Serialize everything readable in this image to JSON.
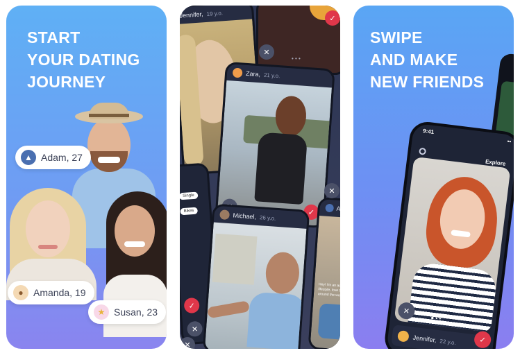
{
  "panel1": {
    "headline": [
      "START",
      "YOUR DATING",
      "JOURNEY"
    ],
    "tags": [
      {
        "name": "Adam, 27",
        "icon": "mountain-icon",
        "color": "#4a6fb0"
      },
      {
        "name": "Amanda, 19",
        "icon": "teddy-bear-icon",
        "color": "#f4d9b4"
      },
      {
        "name": "Susan, 23",
        "icon": "star-icon",
        "color": "#f8d8e8"
      }
    ]
  },
  "panel2": {
    "cards": [
      {
        "name": "Jennifer,",
        "age": "19 y.o."
      },
      {
        "name": "Zara,",
        "age": "21 y.o."
      },
      {
        "name": "Michael,",
        "age": "26 y.o."
      },
      {
        "name": "Ar"
      }
    ],
    "chips": [
      "Single",
      "Bikes"
    ],
    "caption": "Hey! I'm an active lifestyle, love to travel around the world..."
  },
  "panel3": {
    "headline": [
      "SWIPE",
      "AND MAKE",
      "NEW FRIENDS"
    ],
    "phone": {
      "time": "9:41",
      "title": "Explore",
      "name": "Jennifer,",
      "age": "22 y.o."
    }
  },
  "colors": {
    "accent_red": "#e0374a",
    "dark_card": "#262c42",
    "gradient_blue": "#5fb0f5",
    "gradient_purple": "#8a84ef"
  }
}
